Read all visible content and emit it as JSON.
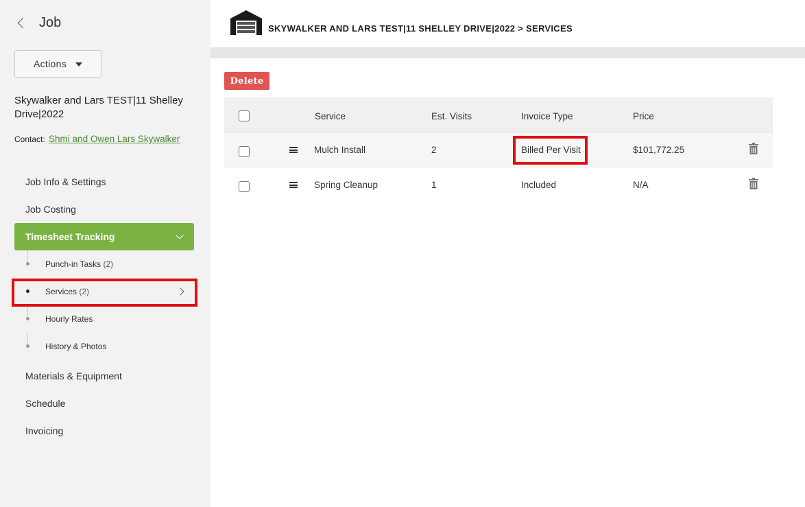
{
  "sidebar": {
    "back_title": "Job",
    "actions_label": "Actions",
    "job_name": "Skywalker and Lars TEST|11 Shelley Drive|2022",
    "contact_label": "Contact:",
    "contact_name": "Shmi and Owen Lars Skywalker",
    "nav": {
      "job_info": "Job Info & Settings",
      "job_costing": "Job Costing",
      "timesheet_tracking": "Timesheet Tracking",
      "materials": "Materials & Equipment",
      "schedule": "Schedule",
      "invoicing": "Invoicing"
    },
    "sub": {
      "punch_in": {
        "label": "Punch-in Tasks",
        "count": "(2)"
      },
      "services": {
        "label": "Services",
        "count": "(2)"
      },
      "hourly_rates": {
        "label": "Hourly Rates"
      },
      "history": {
        "label": "History & Photos"
      }
    }
  },
  "header": {
    "breadcrumb": "SKYWALKER AND LARS TEST|11 SHELLEY DRIVE|2022 > SERVICES"
  },
  "toolbar": {
    "delete_label": "Delete"
  },
  "table": {
    "columns": {
      "service": "Service",
      "est_visits": "Est. Visits",
      "invoice_type": "Invoice Type",
      "price": "Price"
    },
    "rows": [
      {
        "service": "Mulch Install",
        "est_visits": "2",
        "invoice_type": "Billed Per Visit",
        "price": "$101,772.25"
      },
      {
        "service": "Spring Cleanup",
        "est_visits": "1",
        "invoice_type": "Included",
        "price": "N/A"
      }
    ]
  },
  "colors": {
    "accent_green": "#7ab342",
    "link_green": "#4a8a2c",
    "delete_red": "#e05454",
    "highlight_red": "#e01010"
  },
  "icons": [
    "back-chevron-icon",
    "caret-down-icon",
    "chevron-down-icon",
    "chevron-right-icon",
    "house-icon",
    "drag-handle-icon",
    "trash-icon"
  ]
}
